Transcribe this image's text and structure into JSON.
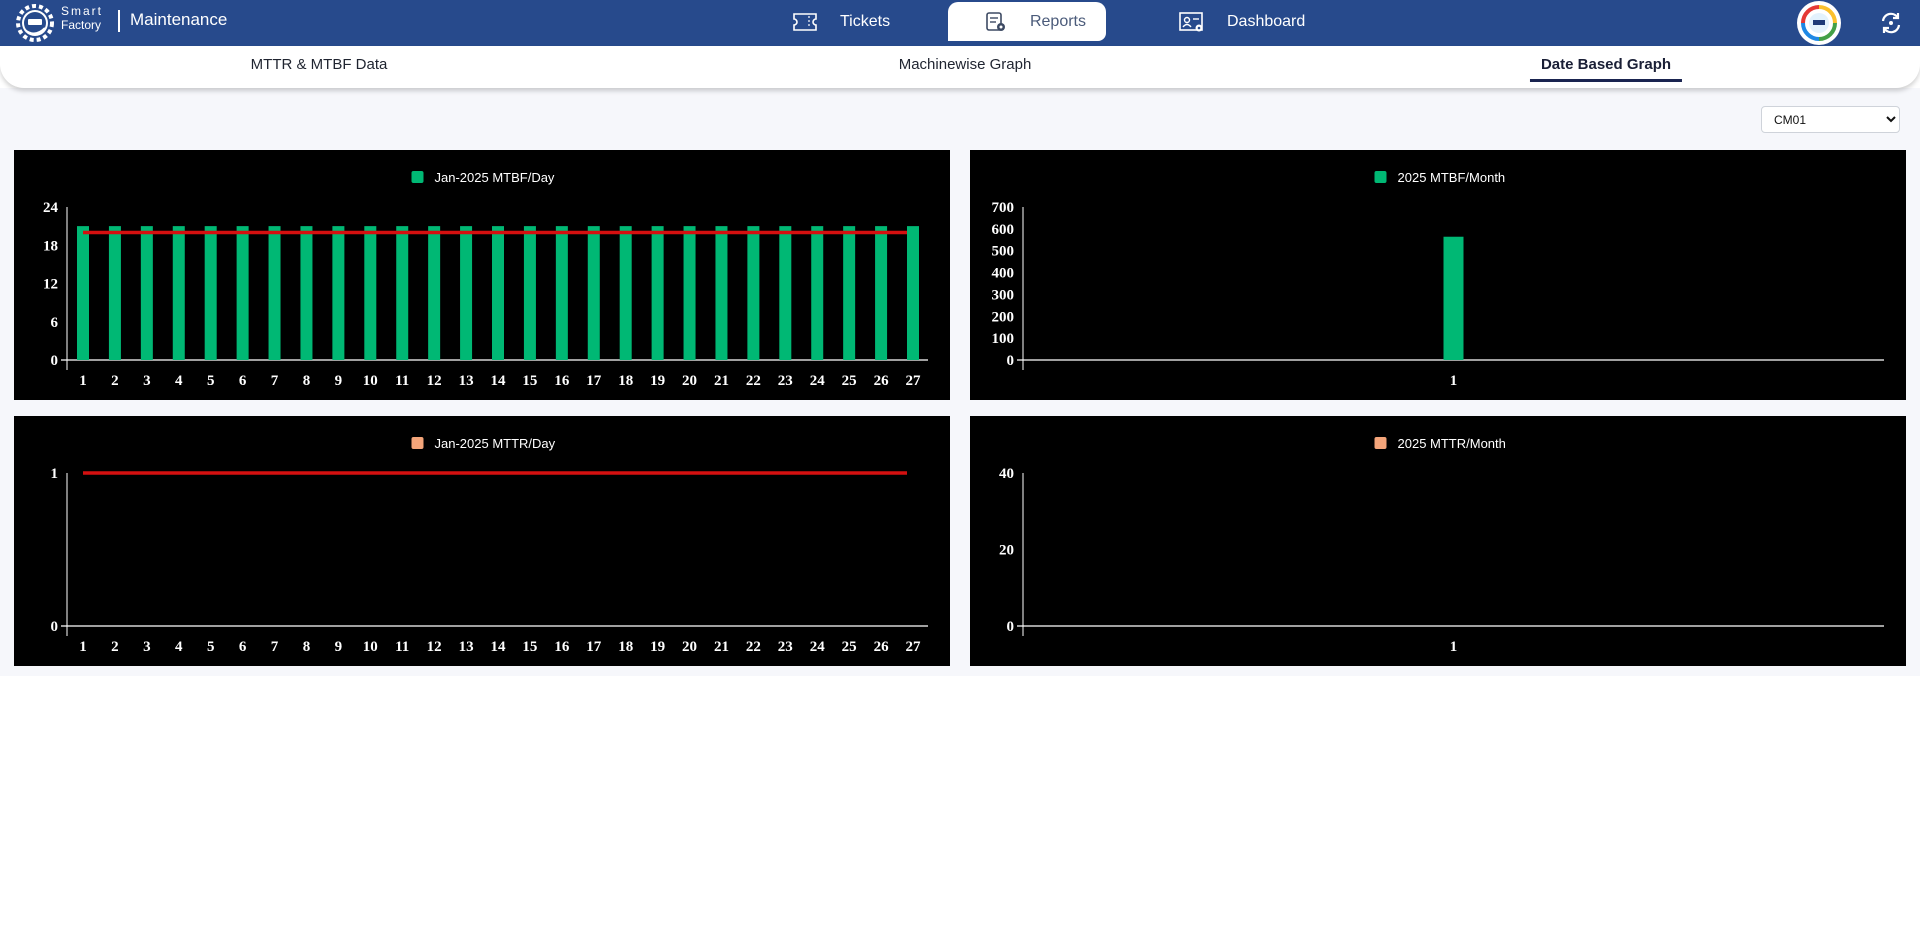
{
  "header": {
    "brand_line1": "Smart",
    "brand_line2": "Factory",
    "app_title": "Maintenance",
    "nav": [
      {
        "label": "Tickets",
        "icon": "ticket-icon",
        "active": false
      },
      {
        "label": "Reports",
        "icon": "report-settings-icon",
        "active": true
      },
      {
        "label": "Dashboard",
        "icon": "dashboard-user-settings-icon",
        "active": false
      }
    ],
    "avatar_icon": "company-logo-avatar",
    "refresh_icon": "refresh-icon",
    "colors": {
      "header_bg": "#274a8c",
      "active_tab_bg": "#ffffff"
    }
  },
  "subtabs": [
    {
      "label": "MTTR & MTBF Data",
      "active": false
    },
    {
      "label": "Machinewise Graph",
      "active": false
    },
    {
      "label": "Date Based Graph",
      "active": true
    }
  ],
  "filter": {
    "machine_selected": "CM01"
  },
  "chart_data": [
    {
      "id": "mtbf-day",
      "type": "bar",
      "title": "Jan-2025 MTBF/Day",
      "legend": "Jan-2025 MTBF/Day",
      "legend_color": "#00b874",
      "categories": [
        "1",
        "2",
        "3",
        "4",
        "5",
        "6",
        "7",
        "8",
        "9",
        "10",
        "11",
        "12",
        "13",
        "14",
        "15",
        "16",
        "17",
        "18",
        "19",
        "20",
        "21",
        "22",
        "23",
        "24",
        "25",
        "26",
        "27"
      ],
      "values": [
        21,
        21,
        21,
        21,
        21,
        21,
        21,
        21,
        21,
        21,
        21,
        21,
        21,
        21,
        21,
        21,
        21,
        21,
        21,
        21,
        21,
        21,
        21,
        21,
        21,
        21,
        21
      ],
      "bar_color": "#00b874",
      "reference_line": {
        "value": 20,
        "color": "#d41010",
        "from": "1",
        "to": "27"
      },
      "yticks": [
        0,
        6,
        12,
        18,
        24
      ],
      "ylim": [
        0,
        24
      ],
      "xlabel": "",
      "ylabel": "",
      "grid": false,
      "legend_position": "top-center"
    },
    {
      "id": "mtbf-month",
      "type": "bar",
      "title": "2025 MTBF/Month",
      "legend": "2025 MTBF/Month",
      "legend_color": "#00b874",
      "categories": [
        "1"
      ],
      "values": [
        564
      ],
      "bar_color": "#00b874",
      "yticks": [
        0,
        100,
        200,
        300,
        400,
        500,
        600,
        700
      ],
      "ylim": [
        0,
        700
      ],
      "xlabel": "",
      "ylabel": "",
      "grid": false,
      "legend_position": "top-center"
    },
    {
      "id": "mttr-day",
      "type": "bar",
      "title": "Jan-2025 MTTR/Day",
      "legend": "Jan-2025 MTTR/Day",
      "legend_color": "#f4a57a",
      "categories": [
        "1",
        "2",
        "3",
        "4",
        "5",
        "6",
        "7",
        "8",
        "9",
        "10",
        "11",
        "12",
        "13",
        "14",
        "15",
        "16",
        "17",
        "18",
        "19",
        "20",
        "21",
        "22",
        "23",
        "24",
        "25",
        "26",
        "27"
      ],
      "values": [
        0,
        0,
        0,
        0,
        0,
        0,
        0,
        0,
        0,
        0,
        0,
        0,
        0,
        0,
        0,
        0,
        0,
        0,
        0,
        0,
        0,
        0,
        0,
        0,
        0,
        0,
        0
      ],
      "bar_color": "#f4a57a",
      "reference_line": {
        "value": 1,
        "color": "#d41010",
        "from": "1",
        "to": "27"
      },
      "yticks": [
        0,
        1
      ],
      "ylim": [
        0,
        1
      ],
      "xlabel": "",
      "ylabel": "",
      "grid": false,
      "legend_position": "top-center"
    },
    {
      "id": "mttr-month",
      "type": "bar",
      "title": "2025 MTTR/Month",
      "legend": "2025 MTTR/Month",
      "legend_color": "#f4a57a",
      "categories": [
        "1"
      ],
      "values": [
        0
      ],
      "bar_color": "#f4a57a",
      "yticks": [
        0,
        20,
        40
      ],
      "ylim": [
        0,
        40
      ],
      "xlabel": "",
      "ylabel": "",
      "grid": false,
      "legend_position": "top-center"
    }
  ]
}
